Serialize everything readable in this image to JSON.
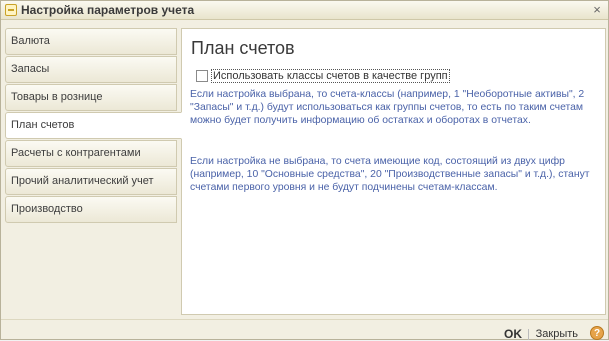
{
  "window": {
    "title": "Настройка параметров учета",
    "close_glyph": "×"
  },
  "sidebar": {
    "items": [
      {
        "label": "Валюта"
      },
      {
        "label": "Запасы"
      },
      {
        "label": "Товары в рознице"
      },
      {
        "label": "План счетов",
        "active": true
      },
      {
        "label": "Расчеты с контрагентами"
      },
      {
        "label": "Прочий аналитический учет"
      },
      {
        "label": "Производство"
      }
    ]
  },
  "main": {
    "heading": "План счетов",
    "checkbox_label": "Использовать классы счетов в качестве групп",
    "checkbox_checked": false,
    "help_1": "Если настройка выбрана, то счета-классы (например, 1 \"Необоротные активы\", 2 \"Запасы\" и т.д.) будут использоваться как группы счетов, то есть по  таким счетам можно будет получить информацию об остатках и оборотах в отчетах.",
    "help_2": "Если настройка не выбрана, то счета имеющие код, состоящий из двух цифр (например, 10 \"Основные средства\",  20 \"Производственные запасы\" и т.д.), станут счетами первого уровня и не будут подчинены счетам-классам."
  },
  "footer": {
    "ok_label": "OK",
    "close_label": "Закрыть",
    "help_glyph": "?"
  },
  "colors": {
    "help_text": "#4a62a8",
    "window_bg": "#f2efe2",
    "help_button": "#e6a34a"
  }
}
